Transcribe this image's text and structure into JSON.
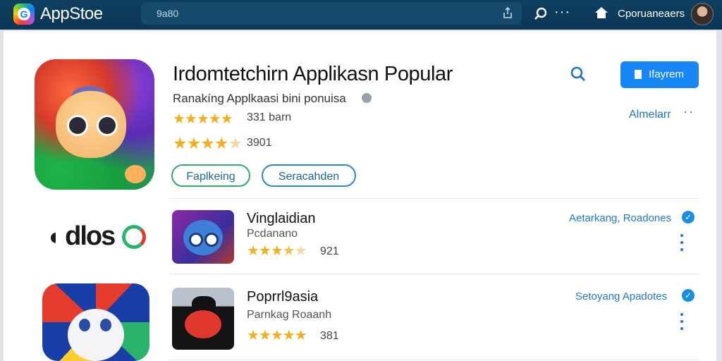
{
  "topbar": {
    "app_name": "AppStoe",
    "search_query": "9a80",
    "account_label": "Cporuaneaers"
  },
  "hero": {
    "title": "Irdomtetchirn Applikasn Popular",
    "subtitle": "Ranakíng Applkaasi bini ponuisa",
    "rating_primary_text": "331 barn",
    "rating_primary_value": 5,
    "rating_secondary_text": "3901",
    "rating_secondary_value": 4,
    "pill_green": "Faplkeing",
    "pill_blue": "Seracahden",
    "primary_button": "Ifayrem",
    "link_all": "Almelarr"
  },
  "brand": {
    "logo_text": "dlos"
  },
  "apps": [
    {
      "name": "Vinglaidian",
      "sub": "Pcdanano",
      "rating_text": "921",
      "rating_value": 3.5,
      "tag": "Aetarkang, Roadones"
    },
    {
      "name": "Poprrl9asia",
      "sub": "Parnkag Roaanh",
      "rating_text": "381",
      "rating_value": 5,
      "tag": "Setoyang Apadotes"
    }
  ],
  "colors": {
    "topbar": "#0f3f5f",
    "accent": "#1687f5",
    "star": "#f2b01e",
    "link": "#2079c8"
  }
}
